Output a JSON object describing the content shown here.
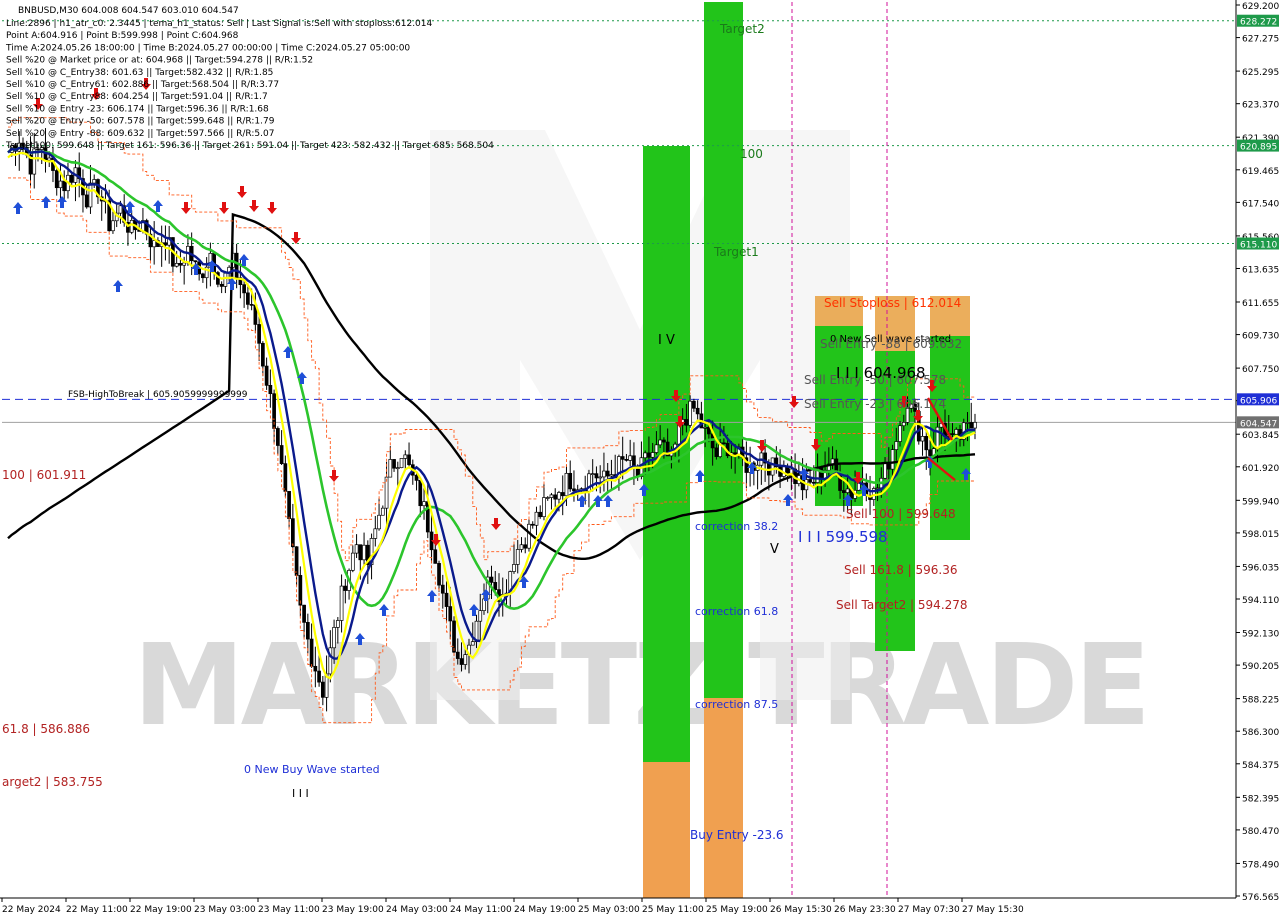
{
  "header": {
    "symbol_line": "BNBUSD,M30  604.008 604.547 603.010 604.547",
    "lines": [
      "Line:2896 | h1_atr_c0: 2.3445 | tema_h1_status: Sell | Last Signal is:Sell with stoploss:612.014",
      "Point A:604.916 | Point B:599.998 | Point C:604.968",
      "Time A:2024.05.26 18:00:00 | Time B:2024.05.27 00:00:00 | Time C:2024.05.27 05:00:00",
      "Sell %20 @ Market price or at: 604.968 || Target:594.278 || R/R:1.52",
      "Sell %10 @ C_Entry38: 601.63 || Target:582.432 || R/R:1.85",
      "Sell %10 @ C_Entry61: 602.886 || Target:568.504 || R/R:3.77",
      "Sell %10 @ C_Entry88: 604.254 || Target:591.04 || R/R:1.7",
      "Sell %10 @ Entry -23: 606.174 || Target:596.36 || R/R:1.68",
      "Sell %20 @ Entry -50: 607.578 || Target:599.648 || R/R:1.79",
      "Sell %20 @ Entry -88: 609.632 || Target:597.566 || R/R:5.07",
      "Target100: 599.648 || Target 161: 596.36 || Target 261: 591.04 || Target 423: 582.432 || Target 685: 568.504"
    ]
  },
  "price_axis": {
    "ticks": [
      "629.200",
      "627.275",
      "625.295",
      "623.370",
      "621.390",
      "619.465",
      "617.540",
      "615.560",
      "613.635",
      "611.655",
      "609.730",
      "607.750",
      "605.825",
      "603.845",
      "601.920",
      "599.940",
      "598.015",
      "596.035",
      "594.110",
      "592.130",
      "590.205",
      "588.225",
      "586.300",
      "584.375",
      "582.395",
      "580.470",
      "578.490",
      "576.565"
    ],
    "tags": [
      {
        "label": "628.272",
        "value": 628.272,
        "color": "#1e9a4a"
      },
      {
        "label": "620.895",
        "value": 620.895,
        "color": "#1e9a4a"
      },
      {
        "label": "615.110",
        "value": 615.11,
        "color": "#1e9a4a"
      },
      {
        "label": "605.906",
        "value": 605.906,
        "color": "#1f2fd6"
      },
      {
        "label": "604.547",
        "value": 604.547,
        "color": "#707070"
      }
    ]
  },
  "time_axis": {
    "ticks": [
      "22 May 2024",
      "22 May 11:00",
      "22 May 19:00",
      "23 May 03:00",
      "23 May 11:00",
      "23 May 19:00",
      "24 May 03:00",
      "24 May 11:00",
      "24 May 19:00",
      "25 May 03:00",
      "25 May 11:00",
      "25 May 19:00",
      "26 May 15:30",
      "26 May 23:30",
      "27 May 07:30",
      "27 May 15:30"
    ]
  },
  "labels": {
    "watermark": "MARKETZITRADE",
    "fsb": "FSB-HighToBreak | 605.9059999999999",
    "left_100": "100 | 601.911",
    "left_618": "61.8 | 586.886",
    "left_target2": "arget2 | 583.755",
    "new_buy_wave": "0 New Buy Wave started",
    "target2": "Target2",
    "target1": "Target1",
    "hundred": "100",
    "correction382": "correction 38.2",
    "correction618": "correction 61.8",
    "correction875": "correction 87.5",
    "buy_entry": "Buy Entry -23.6",
    "sell_stoploss": "Sell Stoploss | 612.014",
    "new_sell_wave": "0 New Sell wave started",
    "sell_entry_88": "Sell Entry -88 | 609.632",
    "sell_entry_50": "Sell Entry -50 | 607.578",
    "sell_entry_23": "Sell Entry -23 | 606.174",
    "point_c": "I I I 604.968",
    "point_b": "I I I 599.598",
    "sell_100": "Sell 100 | 599.648",
    "sell_1618": "Sell 161.8 | 596.36",
    "sell_target2": "Sell Target2 | 594.278",
    "wave_iv": "I V",
    "wave_v": "V",
    "wave_iii": "I I I"
  },
  "colors": {
    "green_zone": "#22c41a",
    "orange_zone": "#f0a050",
    "sell_zone_orange": "#e8a040",
    "ema_black": "#000000",
    "ma_green": "#2cc52c",
    "ma_navy": "#0a1a8c",
    "ma_yellow": "#ffff00",
    "band_red": "#ff5a1a",
    "up_arrow": "#1f4fd8",
    "down_arrow": "#e01010",
    "magenta": "#d0109a",
    "fsb_blue": "#1f2fd6"
  },
  "chart_data": {
    "type": "candlestick",
    "symbol": "BNBUSD",
    "timeframe": "M30",
    "last_price": 604.547,
    "ylim": [
      576.0,
      630.0
    ],
    "key_levels": {
      "fsb_high_to_break": 605.906,
      "sell_stoploss": 612.014,
      "sell_entry_88": 609.632,
      "sell_entry_50": 607.578,
      "sell_entry_23": 606.174,
      "point_c": 604.968,
      "point_b": 599.598,
      "sell_target_100": 599.648,
      "sell_target_1618": 596.36,
      "sell_target2": 594.278,
      "target_dotted": [
        628.272,
        620.895,
        615.11
      ]
    },
    "close_path": [
      620.5,
      621.4,
      619.8,
      620.9,
      619.2,
      618.6,
      619.5,
      617.9,
      618.4,
      616.3,
      617.1,
      615.8,
      616.4,
      614.9,
      615.6,
      613.4,
      614.8,
      613.1,
      614.6,
      612.7,
      613.9,
      612.2,
      610.4,
      607.1,
      603.5,
      598.2,
      593.4,
      590.8,
      588.7,
      592.1,
      595.3,
      597.4,
      596.2,
      599.1,
      601.8,
      602.9,
      601.2,
      599.4,
      596.8,
      593.2,
      590.6,
      591.4,
      593.8,
      595.6,
      594.2,
      596.7,
      597.8,
      598.9,
      599.8,
      600.6,
      601.2,
      600.9,
      601.6,
      601.1,
      601.8,
      602.3,
      601.4,
      602.6,
      603.1,
      602.2,
      604.8,
      605.3,
      603.9,
      602.6,
      603.2,
      602.4,
      601.9,
      602.7,
      601.8,
      602.1,
      601.3,
      600.6,
      601.4,
      602.2,
      601.1,
      600.4,
      601.2,
      600.3,
      601.6,
      603.8,
      605.9,
      604.1,
      602.8,
      604.5,
      603.3,
      603.9,
      604.547
    ]
  }
}
